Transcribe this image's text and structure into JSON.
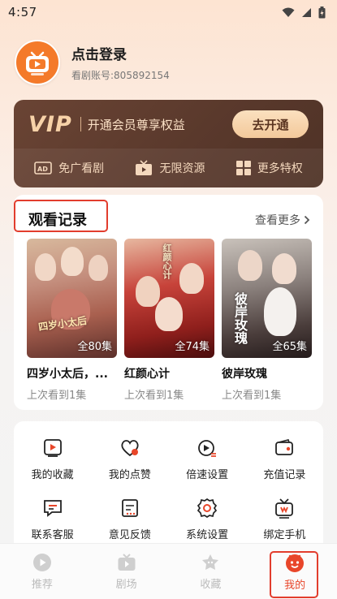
{
  "status_bar": {
    "time": "4:57",
    "icons": [
      "wifi-icon",
      "signal-icon",
      "battery-icon"
    ]
  },
  "profile": {
    "login_label": "点击登录",
    "account_line": "看剧账号:805892154"
  },
  "vip": {
    "logo": "VIP",
    "description": "开通会员尊享权益",
    "button_label": "去开通",
    "perks": [
      {
        "icon": "ad-free-icon",
        "label": "免广看剧"
      },
      {
        "icon": "tv-icon",
        "label": "无限资源"
      },
      {
        "icon": "grid-icon",
        "label": "更多特权"
      }
    ]
  },
  "history": {
    "title": "观看记录",
    "see_more": "查看更多",
    "items": [
      {
        "title": "四岁小太后，...",
        "progress": "上次看到1集",
        "episodes": "全80集",
        "poster_text": "四岁小太后"
      },
      {
        "title": "红颜心计",
        "progress": "上次看到1集",
        "episodes": "全74集",
        "poster_text": "红颜心计"
      },
      {
        "title": "彼岸玫瑰",
        "progress": "上次看到1集",
        "episodes": "全65集",
        "poster_text": "彼岸玫瑰"
      }
    ]
  },
  "functions": [
    {
      "icon": "favorites-icon",
      "label": "我的收藏"
    },
    {
      "icon": "likes-icon",
      "label": "我的点赞"
    },
    {
      "icon": "speed-icon",
      "label": "倍速设置"
    },
    {
      "icon": "wallet-icon",
      "label": "充值记录"
    },
    {
      "icon": "customer-service-icon",
      "label": "联系客服"
    },
    {
      "icon": "feedback-icon",
      "label": "意见反馈"
    },
    {
      "icon": "settings-icon",
      "label": "系统设置"
    },
    {
      "icon": "bind-phone-icon",
      "label": "绑定手机"
    }
  ],
  "nav": {
    "items": [
      {
        "icon": "play-icon",
        "label": "推荐"
      },
      {
        "icon": "theater-icon",
        "label": "剧场"
      },
      {
        "icon": "star-icon",
        "label": "收藏"
      },
      {
        "icon": "mine-icon",
        "label": "我的"
      }
    ],
    "active": "我的"
  },
  "colors": {
    "accent": "#e8462a",
    "highlight_box": "#e23d2d",
    "vip_bg": "#5a392c",
    "vip_gold": "#f7d2a8"
  }
}
